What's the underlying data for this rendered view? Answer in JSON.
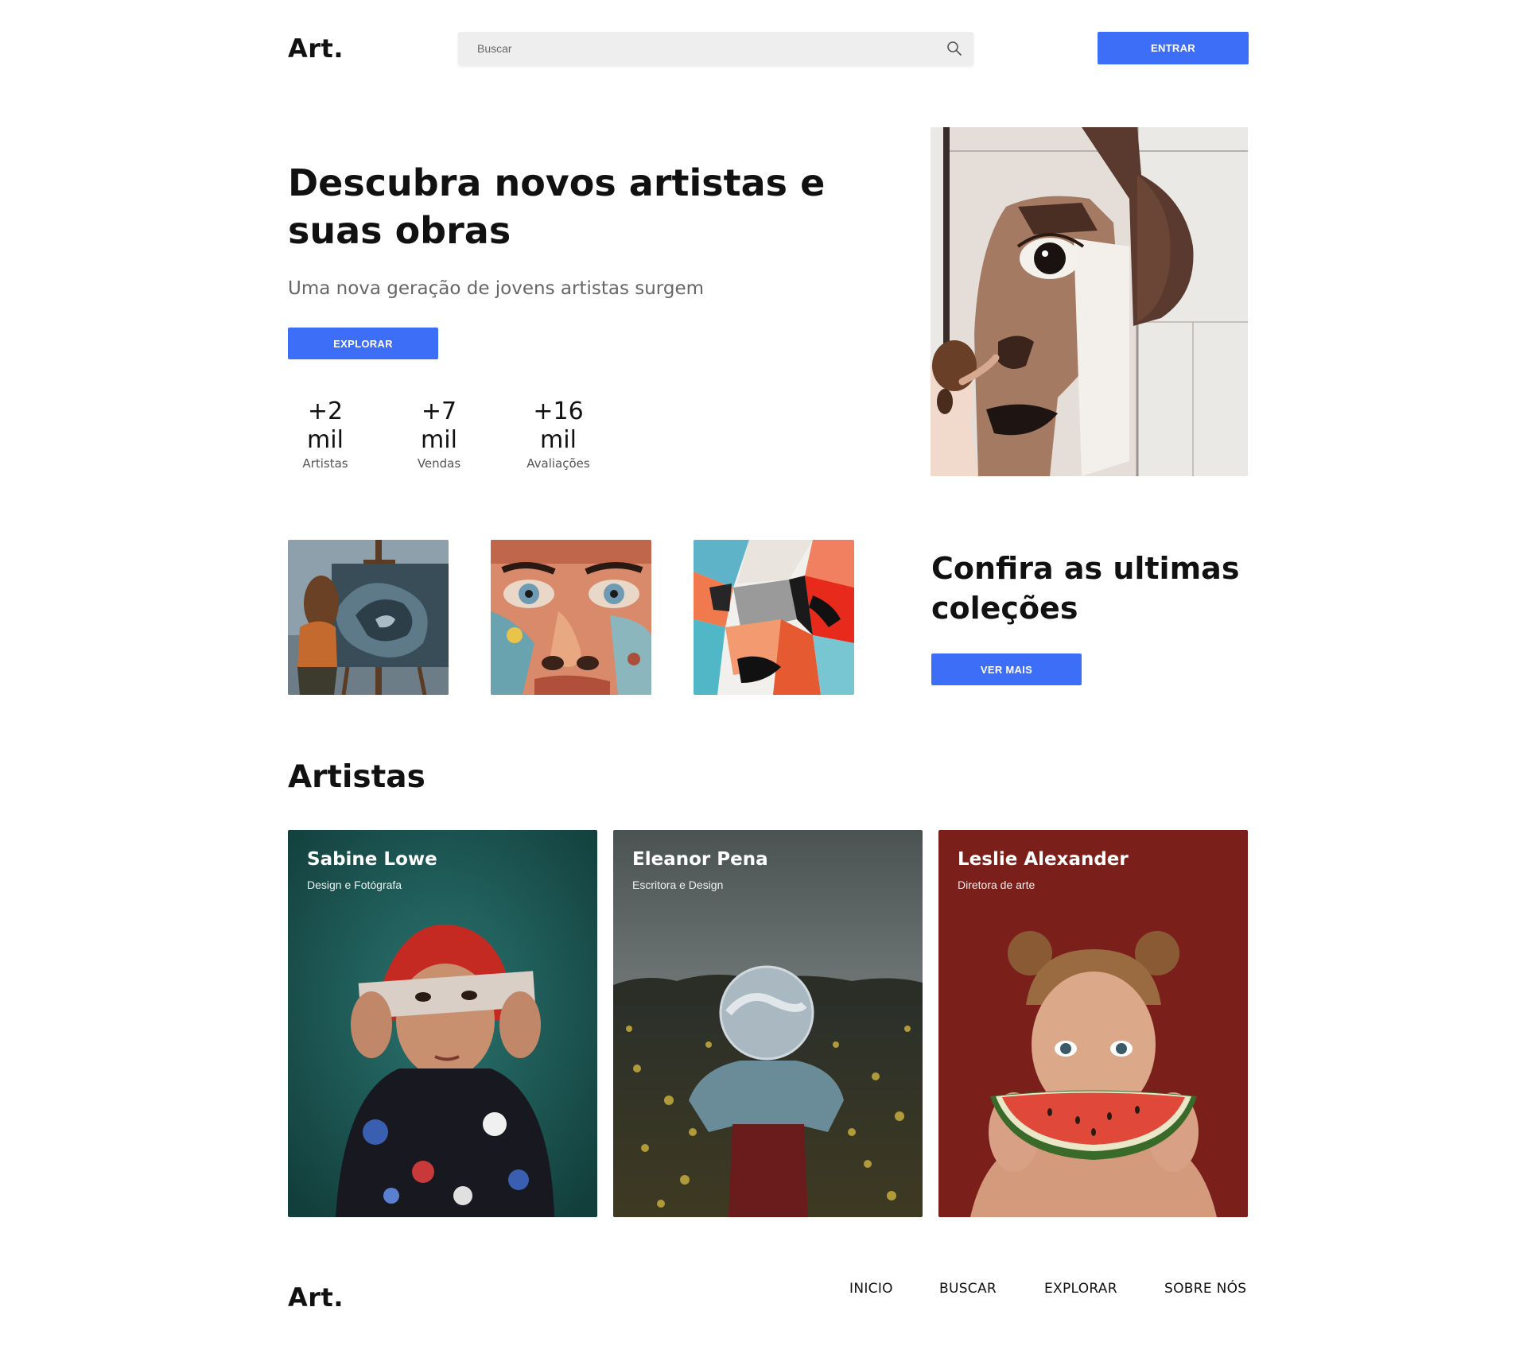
{
  "header": {
    "logo": "Art.",
    "search_placeholder": "Buscar",
    "login_label": "ENTRAR"
  },
  "hero": {
    "title": "Descubra novos artistas e suas obras",
    "subtitle": "Uma nova geração de jovens artistas surgem",
    "explore_label": "EXPLORAR",
    "stats": [
      {
        "value": "+2 mil",
        "label": "Artistas"
      },
      {
        "value": "+7 mil",
        "label": "Vendas"
      },
      {
        "value": "+16 mil",
        "label": "Avaliações"
      }
    ]
  },
  "collections": {
    "title": "Confira as ultimas coleções",
    "more_label": "VER MAIS"
  },
  "artists": {
    "title": "Artistas",
    "cards": [
      {
        "name": "Sabine Lowe",
        "role": "Design e Fotógrafa"
      },
      {
        "name": "Eleanor Pena",
        "role": "Escritora e Design"
      },
      {
        "name": "Leslie Alexander",
        "role": "Diretora de arte"
      }
    ]
  },
  "footer": {
    "logo": "Art.",
    "nav": [
      "INICIO",
      "BUSCAR",
      "EXPLORAR",
      "SOBRE NÓS"
    ]
  },
  "colors": {
    "accent": "#3d6ef7",
    "search_bg": "#eeeeee",
    "card1_bg": "#1e5a55",
    "card2_bg": "#4d5555",
    "card3_bg": "#7a1f1a"
  }
}
